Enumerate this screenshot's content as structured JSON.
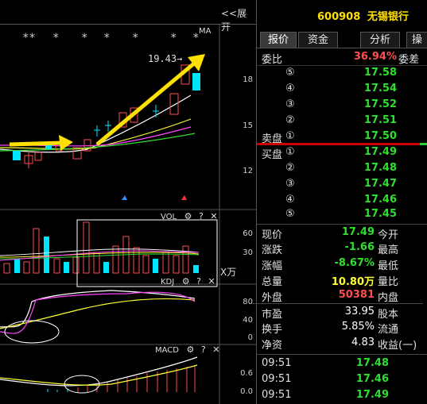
{
  "header": {
    "expand_label": "<<展开",
    "stock_code": "600908",
    "stock_name": "无锡银行"
  },
  "tabs": [
    {
      "label": "报价",
      "active": true
    },
    {
      "label": "资金",
      "active": false
    },
    {
      "label": "分析",
      "active": false
    },
    {
      "label": "操",
      "active": false
    }
  ],
  "chart": {
    "ma_label": "MA",
    "price_high_label": "19.43",
    "arrow_glyph": "→",
    "y_axis_ticks": [
      "18",
      "15",
      "12"
    ],
    "star_labels": [
      "**",
      "*",
      "*",
      "*",
      "*",
      "*",
      "*"
    ],
    "vol": {
      "label": "VOL",
      "ticks": [
        "60",
        "30"
      ],
      "unit": "X万"
    },
    "kdj": {
      "label": "KDJ",
      "ticks": [
        "80",
        "40",
        "0"
      ]
    },
    "macd": {
      "label": "MACD",
      "ticks": [
        "0.6",
        "0.0"
      ]
    },
    "panel_icons": {
      "gear": "⚙",
      "help": "?",
      "close": "✕"
    }
  },
  "quote": {
    "weibi": {
      "label": "委比",
      "value": "36.94%",
      "label2": "委差"
    },
    "sell": [
      {
        "label": "",
        "idx": "⑤",
        "price": "17.58"
      },
      {
        "label": "",
        "idx": "④",
        "price": "17.54"
      },
      {
        "label": "",
        "idx": "③",
        "price": "17.52"
      },
      {
        "label": "",
        "idx": "②",
        "price": "17.51"
      },
      {
        "label": "卖盘",
        "idx": "①",
        "price": "17.50"
      }
    ],
    "buy": [
      {
        "label": "买盘",
        "idx": "①",
        "price": "17.49"
      },
      {
        "label": "",
        "idx": "②",
        "price": "17.48"
      },
      {
        "label": "",
        "idx": "③",
        "price": "17.47"
      },
      {
        "label": "",
        "idx": "④",
        "price": "17.46"
      },
      {
        "label": "",
        "idx": "⑤",
        "price": "17.45"
      }
    ],
    "stats": [
      {
        "l1": "现价",
        "v": "17.49",
        "l2": "今开",
        "color": "green"
      },
      {
        "l1": "涨跌",
        "v": "-1.66",
        "l2": "最高",
        "color": "green"
      },
      {
        "l1": "涨幅",
        "v": "-8.67%",
        "l2": "最低",
        "color": "green"
      },
      {
        "l1": "总量",
        "v": "10.80万",
        "l2": "量比",
        "color": "yellow"
      },
      {
        "l1": "外盘",
        "v": "50381",
        "l2": "内盘",
        "color": "red"
      },
      {
        "l1": "市盈",
        "v": "33.95",
        "l2": "股本",
        "color": "white"
      },
      {
        "l1": "换手",
        "v": "5.85%",
        "l2": "流通",
        "color": "white"
      },
      {
        "l1": "净资",
        "v": "4.83",
        "l2": "收益(一)",
        "color": "white"
      }
    ],
    "ticks": [
      {
        "time": "09:51",
        "price": "17.48"
      },
      {
        "time": "09:51",
        "price": "17.46"
      },
      {
        "time": "09:51",
        "price": "17.49"
      }
    ]
  },
  "colors": {
    "up": "#ff4d4d",
    "down": "#00e5ff",
    "accent": "#ffe000",
    "divider": "#cc0000"
  }
}
